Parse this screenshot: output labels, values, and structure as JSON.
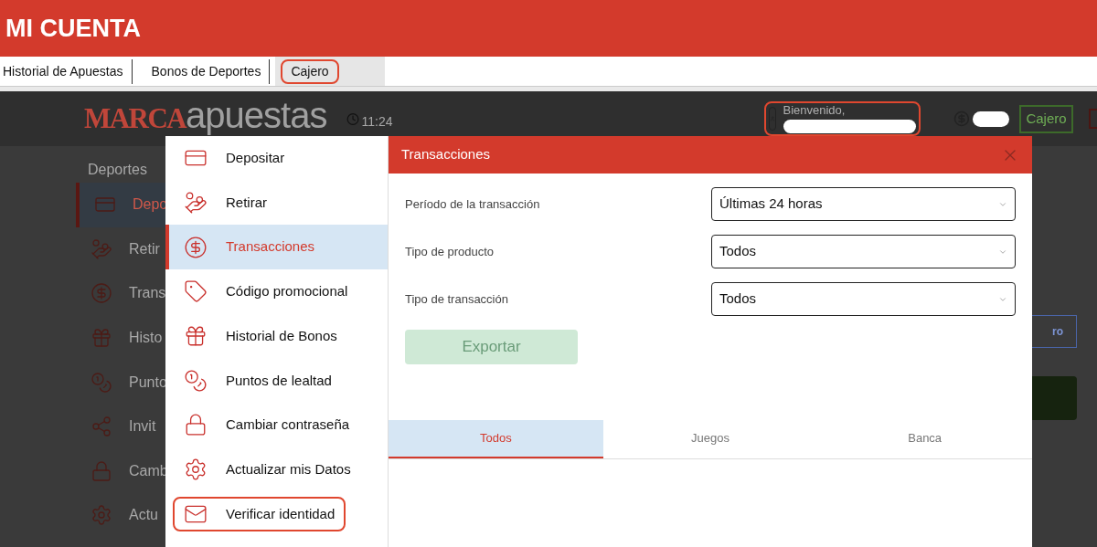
{
  "header": {
    "title": "MI CUENTA"
  },
  "tabs": [
    {
      "label": "Historial de Apuestas",
      "selected": false,
      "highlighted": false
    },
    {
      "label": "Bonos de Deportes",
      "selected": false,
      "highlighted": false
    },
    {
      "label": "Cajero",
      "selected": true,
      "highlighted": true
    }
  ],
  "site": {
    "logo_left": "MARCA",
    "logo_right": "apuestas",
    "time": "11:24",
    "greeting": "Bienvenido,",
    "greeting_highlighted": true,
    "cashier_button": "Cajero",
    "nav": "Deportes",
    "sidebar": [
      {
        "label": "Depo",
        "selected": true
      },
      {
        "label": "Retir",
        "selected": false
      },
      {
        "label": "Trans",
        "selected": false
      },
      {
        "label": "Histo",
        "selected": false
      },
      {
        "label": "Punto",
        "selected": false
      },
      {
        "label": "Invit",
        "selected": false
      },
      {
        "label": "Camb",
        "selected": false
      },
      {
        "label": "Actu",
        "selected": false
      }
    ],
    "side_button": "ro"
  },
  "modal": {
    "title": "Transacciones",
    "menu": [
      {
        "label": "Depositar",
        "selected": false,
        "highlighted": false
      },
      {
        "label": "Retirar",
        "selected": false,
        "highlighted": false
      },
      {
        "label": "Transacciones",
        "selected": true,
        "highlighted": false
      },
      {
        "label": "Código promocional",
        "selected": false,
        "highlighted": false
      },
      {
        "label": "Historial de Bonos",
        "selected": false,
        "highlighted": false
      },
      {
        "label": "Puntos de lealtad",
        "selected": false,
        "highlighted": false
      },
      {
        "label": "Cambiar contraseña",
        "selected": false,
        "highlighted": false
      },
      {
        "label": "Actualizar mis Datos",
        "selected": false,
        "highlighted": false
      },
      {
        "label": "Verificar identidad",
        "selected": false,
        "highlighted": true
      }
    ],
    "filters": [
      {
        "label": "Período de la transacción",
        "value": "Últimas 24 horas"
      },
      {
        "label": "Tipo de producto",
        "value": "Todos"
      },
      {
        "label": "Tipo de transacción",
        "value": "Todos"
      }
    ],
    "export_button": {
      "label": "Exportar",
      "disabled": true
    },
    "result_tabs": [
      {
        "label": "Todos",
        "selected": true
      },
      {
        "label": "Juegos",
        "selected": false
      },
      {
        "label": "Banca",
        "selected": false
      }
    ]
  }
}
